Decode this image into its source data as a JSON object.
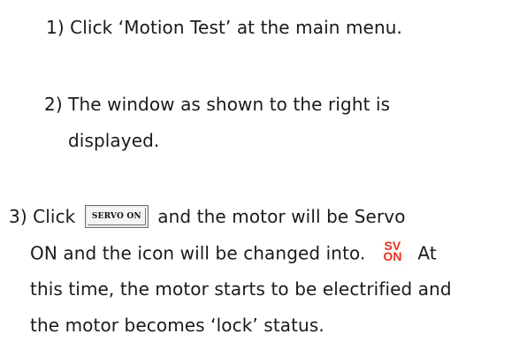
{
  "steps": {
    "step1": "1) Click ‘Motion Test’ at the main menu.",
    "step2_line1": "2) The window as shown to the right is",
    "step2_line2": "displayed.",
    "step3_before_button": "3) Click",
    "servo_button_label": "SERVO ON",
    "step3_after_button": "and the motor will be Servo",
    "step3_line2": "ON and the icon will be changed into.",
    "sv_icon_top": "SV",
    "sv_icon_bottom": "ON",
    "step3_line2_end": "At",
    "step3_line3": "this time, the motor starts to be electrified and",
    "step3_line4": "the motor becomes ‘lock’ status."
  },
  "colors": {
    "text": "#1a1a1a",
    "sv_icon": "#e8312a"
  },
  "icons": {
    "servo_button": "servo-on-button",
    "sv_icon": "servo-on-status-icon"
  }
}
